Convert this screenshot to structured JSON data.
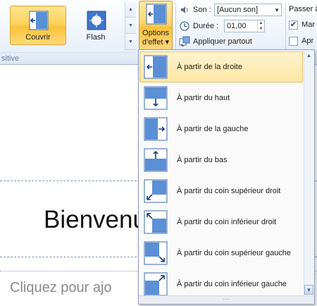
{
  "ribbon": {
    "group_label": "sitive",
    "gallery": [
      {
        "label": "Couvrir",
        "selected": true,
        "icon": "cover-transition-icon"
      },
      {
        "label": "Flash",
        "selected": false,
        "icon": "flash-transition-icon"
      }
    ],
    "effect_options": {
      "line1": "Options",
      "line2": "d'effet ▾",
      "icon": "effect-options-icon"
    },
    "timing": {
      "sound_label": "Son :",
      "sound_value": "[Aucun son]",
      "duration_label": "Durée :",
      "duration_value": "01,00",
      "apply_all_label": "Appliquer partout"
    },
    "advance": {
      "title": "Passer à",
      "on_click_label": "Mar",
      "on_click_checked": true,
      "after_label": "Apr",
      "after_checked": false
    }
  },
  "menu": {
    "items": [
      {
        "label": "À partir de la droite",
        "icon": "from-right-icon",
        "hover": true
      },
      {
        "label": "À partir du haut",
        "icon": "from-top-icon",
        "hover": false
      },
      {
        "label": "À partir de la gauche",
        "icon": "from-left-icon",
        "hover": false
      },
      {
        "label": "À partir du bas",
        "icon": "from-bottom-icon",
        "hover": false
      },
      {
        "label": "À partir du coin supérieur droit",
        "icon": "from-top-right-icon",
        "hover": false
      },
      {
        "label": "À partir du coin inférieur droit",
        "icon": "from-bottom-right-icon",
        "hover": false
      },
      {
        "label": "À partir du coin supérieur gauche",
        "icon": "from-top-left-icon",
        "hover": false
      },
      {
        "label": "À partir du coin inférieur gauche",
        "icon": "from-bottom-left-icon",
        "hover": false
      }
    ],
    "grip": "····"
  },
  "slide": {
    "title": "Bienvenu",
    "subtitle": "Cliquez pour ajo"
  },
  "colors": {
    "accent": "#fbd35c",
    "slide_blue": "#4a7fd0"
  }
}
